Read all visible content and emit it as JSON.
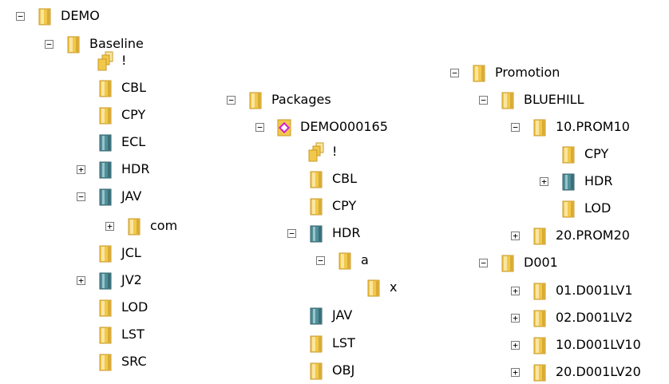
{
  "colors": {
    "folder_yellow": "#f2c84a",
    "folder_light": "#fbe6a0",
    "folder_dark": "#c8982a",
    "folder_teal": "#4f8f9a",
    "package_pink": "#d11fd1"
  },
  "tree": {
    "root": {
      "label": "DEMO",
      "state": "expanded",
      "icon": "folder-icon"
    },
    "baseline": {
      "label": "Baseline",
      "state": "expanded",
      "icon": "folder-icon",
      "items": [
        {
          "label": "!",
          "icon": "folder-stack-icon",
          "state": "none"
        },
        {
          "label": "CBL",
          "icon": "folder-icon",
          "state": "none"
        },
        {
          "label": "CPY",
          "icon": "folder-icon",
          "state": "none"
        },
        {
          "label": "ECL",
          "icon": "folder-teal-icon",
          "state": "none"
        },
        {
          "label": "HDR",
          "icon": "folder-teal-icon",
          "state": "collapsed"
        },
        {
          "label": "JAV",
          "icon": "folder-teal-icon",
          "state": "expanded"
        },
        {
          "label": "com",
          "icon": "folder-icon",
          "state": "collapsed"
        },
        {
          "label": "JCL",
          "icon": "folder-icon",
          "state": "none"
        },
        {
          "label": "JV2",
          "icon": "folder-teal-icon",
          "state": "collapsed"
        },
        {
          "label": "LOD",
          "icon": "folder-icon",
          "state": "none"
        },
        {
          "label": "LST",
          "icon": "folder-icon",
          "state": "none"
        },
        {
          "label": "SRC",
          "icon": "folder-icon",
          "state": "none"
        }
      ]
    },
    "packages": {
      "label": "Packages",
      "state": "expanded",
      "icon": "folder-icon",
      "package": {
        "label": "DEMO000165",
        "state": "expanded",
        "icon": "package-icon"
      },
      "items": [
        {
          "label": "!",
          "icon": "folder-stack-icon",
          "state": "none"
        },
        {
          "label": "CBL",
          "icon": "folder-icon",
          "state": "none"
        },
        {
          "label": "CPY",
          "icon": "folder-icon",
          "state": "none"
        },
        {
          "label": "HDR",
          "icon": "folder-teal-icon",
          "state": "expanded"
        },
        {
          "label": "a",
          "icon": "folder-icon",
          "state": "expanded"
        },
        {
          "label": "x",
          "icon": "folder-icon",
          "state": "none"
        },
        {
          "label": "JAV",
          "icon": "folder-teal-icon",
          "state": "none"
        },
        {
          "label": "LST",
          "icon": "folder-icon",
          "state": "none"
        },
        {
          "label": "OBJ",
          "icon": "folder-icon",
          "state": "none"
        }
      ]
    },
    "promotion": {
      "label": "Promotion",
      "state": "expanded",
      "icon": "folder-icon",
      "items": [
        {
          "label": "BLUEHILL",
          "icon": "folder-icon",
          "state": "expanded"
        },
        {
          "label": "10.PROM10",
          "icon": "folder-icon",
          "state": "expanded"
        },
        {
          "label": "CPY",
          "icon": "folder-icon",
          "state": "none"
        },
        {
          "label": "HDR",
          "icon": "folder-teal-icon",
          "state": "collapsed"
        },
        {
          "label": "LOD",
          "icon": "folder-icon",
          "state": "none"
        },
        {
          "label": "20.PROM20",
          "icon": "folder-icon",
          "state": "collapsed"
        },
        {
          "label": "D001",
          "icon": "folder-icon",
          "state": "expanded"
        },
        {
          "label": "01.D001LV1",
          "icon": "folder-icon",
          "state": "collapsed"
        },
        {
          "label": "02.D001LV2",
          "icon": "folder-icon",
          "state": "collapsed"
        },
        {
          "label": "10.D001LV10",
          "icon": "folder-icon",
          "state": "collapsed"
        },
        {
          "label": "20.D001LV20",
          "icon": "folder-icon",
          "state": "collapsed"
        }
      ]
    }
  }
}
